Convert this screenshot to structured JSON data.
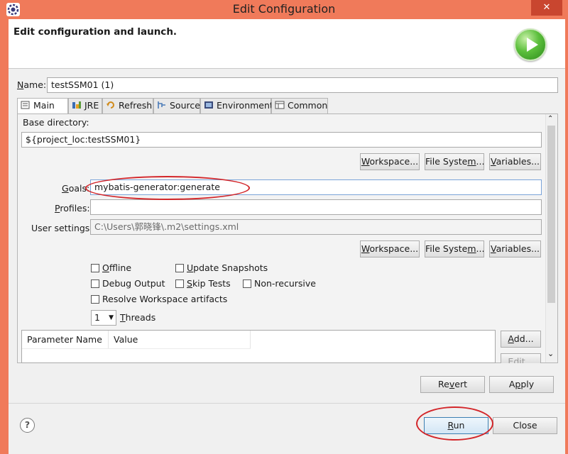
{
  "window": {
    "title": "Edit Configuration",
    "close_glyph": "✕",
    "app_icon": "eclipse-icon"
  },
  "header": {
    "title": "Edit configuration and launch.",
    "launch_icon": "run-launch-icon"
  },
  "name_field": {
    "label": "Name:",
    "value": "testSSM01 (1)"
  },
  "tabs": [
    {
      "label": "Main",
      "icon": "main-tab-icon",
      "active": true
    },
    {
      "label": "JRE",
      "icon": "jre-icon"
    },
    {
      "label": "Refresh",
      "icon": "refresh-icon"
    },
    {
      "label": "Source",
      "icon": "source-icon"
    },
    {
      "label": "Environment",
      "icon": "environment-icon"
    },
    {
      "label": "Common",
      "icon": "common-icon"
    }
  ],
  "main": {
    "base_dir_label": "Base directory:",
    "base_dir_value": "${project_loc:testSSM01}",
    "workspace_btn": "Workspace...",
    "filesystem_btn": "File System...",
    "variables_btn": "Variables...",
    "goals_label": "Goals:",
    "goals_value": "mybatis-generator:generate",
    "profiles_label": "Profiles:",
    "profiles_value": "",
    "user_settings_label": "User settings:",
    "user_settings_value": "C:\\Users\\郭晓锋\\.m2\\settings.xml",
    "checkboxes": {
      "offline": "Offline",
      "update_snapshots": "Update Snapshots",
      "debug_output": "Debug Output",
      "skip_tests": "Skip Tests",
      "non_recursive": "Non-recursive",
      "resolve_workspace": "Resolve Workspace artifacts"
    },
    "threads_value": "1",
    "threads_label": "Threads",
    "param_table": {
      "headers": [
        "Parameter Name",
        "Value"
      ]
    },
    "add_btn": "Add...",
    "edit_btn": "Edit..."
  },
  "footer": {
    "revert_btn": "Revert",
    "apply_btn": "Apply",
    "run_btn": "Run",
    "close_btn": "Close",
    "help_glyph": "?"
  },
  "colors": {
    "window_frame": "#f07a5a",
    "annotation": "#d3262a",
    "launch_green": "#4cb02c"
  }
}
